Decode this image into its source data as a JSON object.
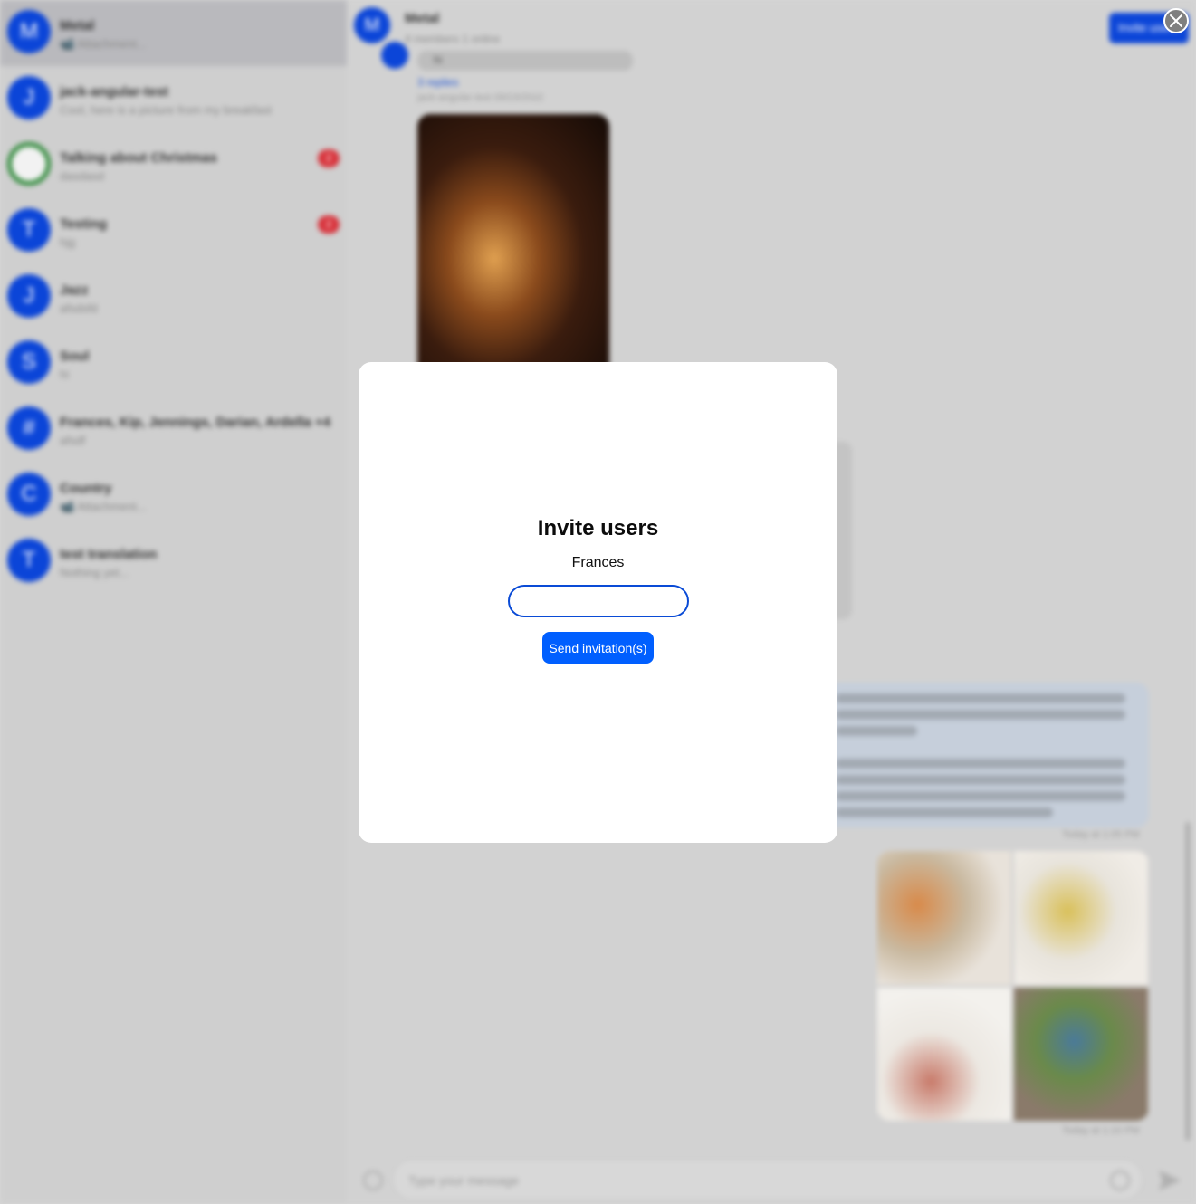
{
  "background": {
    "channels": [
      {
        "avatar_letter": "M",
        "name": "Metal",
        "preview": "📹 Attachment...",
        "active": true
      },
      {
        "avatar_letter": "J",
        "name": "jack-angular-test",
        "preview": "Cool, here is a picture from my breakfast"
      },
      {
        "avatar_letter": "",
        "name": "Talking about Christmas",
        "preview": "dasdasd",
        "unread": "2"
      },
      {
        "avatar_letter": "T",
        "name": "Testing",
        "preview": "hjg",
        "unread": "2"
      },
      {
        "avatar_letter": "J",
        "name": "Jazz",
        "preview": "afsdsfd"
      },
      {
        "avatar_letter": "S",
        "name": "Soul",
        "preview": "hi"
      },
      {
        "avatar_letter": "#",
        "name": "Frances, Kip, Jennings, Darian, Ardella +4",
        "preview": "afsdf"
      },
      {
        "avatar_letter": "C",
        "name": "Country",
        "preview": "📹 Attachment..."
      },
      {
        "avatar_letter": "T",
        "name": "test translation",
        "preview": "Nothing yet..."
      }
    ],
    "chat": {
      "avatar_letter": "M",
      "title": "Metal",
      "subtitle": "4 members 1 online",
      "invite_button": "Invite users",
      "thread_replies": "3 replies",
      "thread_meta": "jack-angular-test 09/23/2022",
      "bubble_text": "hi",
      "long_message_time": "Today at 1:05 PM",
      "image_message_time": "Today at 1:10 PM",
      "composer_placeholder": "Type your message"
    }
  },
  "modal": {
    "title": "Invite users",
    "selected_user": "Frances",
    "input_value": "",
    "send_button": "Send invitation(s)"
  },
  "colors": {
    "accent": "#005fff",
    "input_border": "#0a4bd6",
    "unread_badge": "#d8323b"
  }
}
